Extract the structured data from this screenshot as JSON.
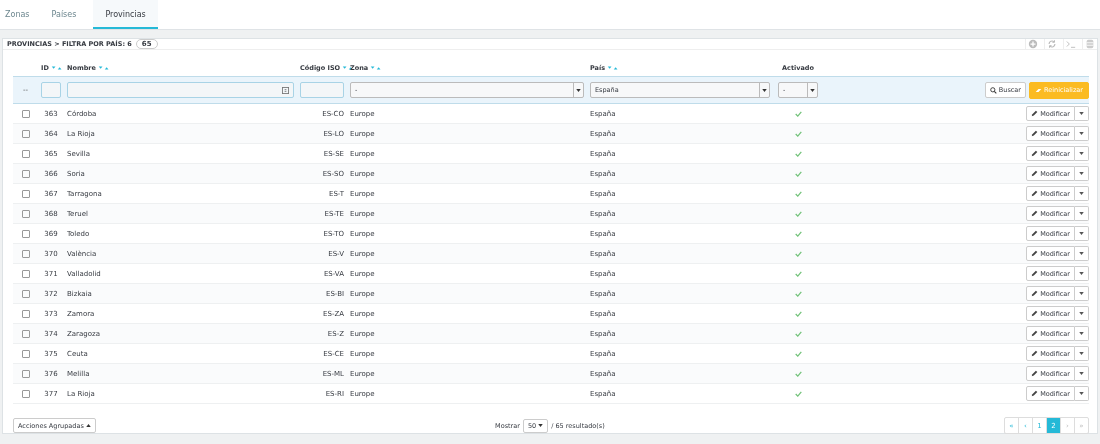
{
  "tabs": [
    {
      "label": "Zonas",
      "selected": false
    },
    {
      "label": "Países",
      "selected": false
    },
    {
      "label": "Provincias",
      "selected": true
    }
  ],
  "panel": {
    "title": "PROVINCIAS > FILTRA POR PAÍS: 6",
    "count": "65"
  },
  "table": {
    "columns": [
      {
        "label": "ID",
        "sortable": true
      },
      {
        "label": "Nombre",
        "sortable": true
      },
      {
        "label": "Código ISO",
        "sortable": true
      },
      {
        "label": "Zona",
        "sortable": true
      },
      {
        "label": "País",
        "sortable": true
      },
      {
        "label": "Activado",
        "sortable": false
      }
    ],
    "filters": {
      "select_all": "--",
      "zona": "-",
      "pais": "España",
      "activado": "-",
      "search_button": "Buscar",
      "reset_button": "Reinicializar"
    },
    "rows": [
      {
        "checked": false,
        "id": "363",
        "name": "Córdoba",
        "iso": "ES-CO",
        "zone": "Europe",
        "country": "España",
        "active": true,
        "action": "Modificar"
      },
      {
        "checked": false,
        "id": "364",
        "name": "La Rioja",
        "iso": "ES-LO",
        "zone": "Europe",
        "country": "España",
        "active": true,
        "action": "Modificar"
      },
      {
        "checked": false,
        "id": "365",
        "name": "Sevilla",
        "iso": "ES-SE",
        "zone": "Europe",
        "country": "España",
        "active": true,
        "action": "Modificar"
      },
      {
        "checked": false,
        "id": "366",
        "name": "Soria",
        "iso": "ES-SO",
        "zone": "Europe",
        "country": "España",
        "active": true,
        "action": "Modificar"
      },
      {
        "checked": false,
        "id": "367",
        "name": "Tarragona",
        "iso": "ES-T",
        "zone": "Europe",
        "country": "España",
        "active": true,
        "action": "Modificar"
      },
      {
        "checked": false,
        "id": "368",
        "name": "Teruel",
        "iso": "ES-TE",
        "zone": "Europe",
        "country": "España",
        "active": true,
        "action": "Modificar"
      },
      {
        "checked": false,
        "id": "369",
        "name": "Toledo",
        "iso": "ES-TO",
        "zone": "Europe",
        "country": "España",
        "active": true,
        "action": "Modificar"
      },
      {
        "checked": false,
        "id": "370",
        "name": "València",
        "iso": "ES-V",
        "zone": "Europe",
        "country": "España",
        "active": true,
        "action": "Modificar"
      },
      {
        "checked": false,
        "id": "371",
        "name": "Valladolid",
        "iso": "ES-VA",
        "zone": "Europe",
        "country": "España",
        "active": true,
        "action": "Modificar"
      },
      {
        "checked": false,
        "id": "372",
        "name": "Bizkaia",
        "iso": "ES-BI",
        "zone": "Europe",
        "country": "España",
        "active": true,
        "action": "Modificar"
      },
      {
        "checked": false,
        "id": "373",
        "name": "Zamora",
        "iso": "ES-ZA",
        "zone": "Europe",
        "country": "España",
        "active": true,
        "action": "Modificar"
      },
      {
        "checked": false,
        "id": "374",
        "name": "Zaragoza",
        "iso": "ES-Z",
        "zone": "Europe",
        "country": "España",
        "active": true,
        "action": "Modificar"
      },
      {
        "checked": false,
        "id": "375",
        "name": "Ceuta",
        "iso": "ES-CE",
        "zone": "Europe",
        "country": "España",
        "active": true,
        "action": "Modificar"
      },
      {
        "checked": false,
        "id": "376",
        "name": "Melilla",
        "iso": "ES-ML",
        "zone": "Europe",
        "country": "España",
        "active": true,
        "action": "Modificar"
      },
      {
        "checked": false,
        "id": "377",
        "name": "La Rioja",
        "iso": "ES-RI",
        "zone": "Europe",
        "country": "España",
        "active": true,
        "action": "Modificar"
      }
    ]
  },
  "footer": {
    "bulk_actions": "Acciones Agrupadas",
    "show_label": "Mostrar",
    "per_page": "50",
    "results": "/ 65 resultado(s)",
    "pages": [
      {
        "label": "«",
        "selected": false,
        "disabled": false
      },
      {
        "label": "‹",
        "selected": false,
        "disabled": false
      },
      {
        "label": "1",
        "selected": false,
        "disabled": false
      },
      {
        "label": "2",
        "selected": true,
        "disabled": false
      },
      {
        "label": "›",
        "selected": false,
        "disabled": true
      },
      {
        "label": "»",
        "selected": false,
        "disabled": true
      }
    ]
  }
}
